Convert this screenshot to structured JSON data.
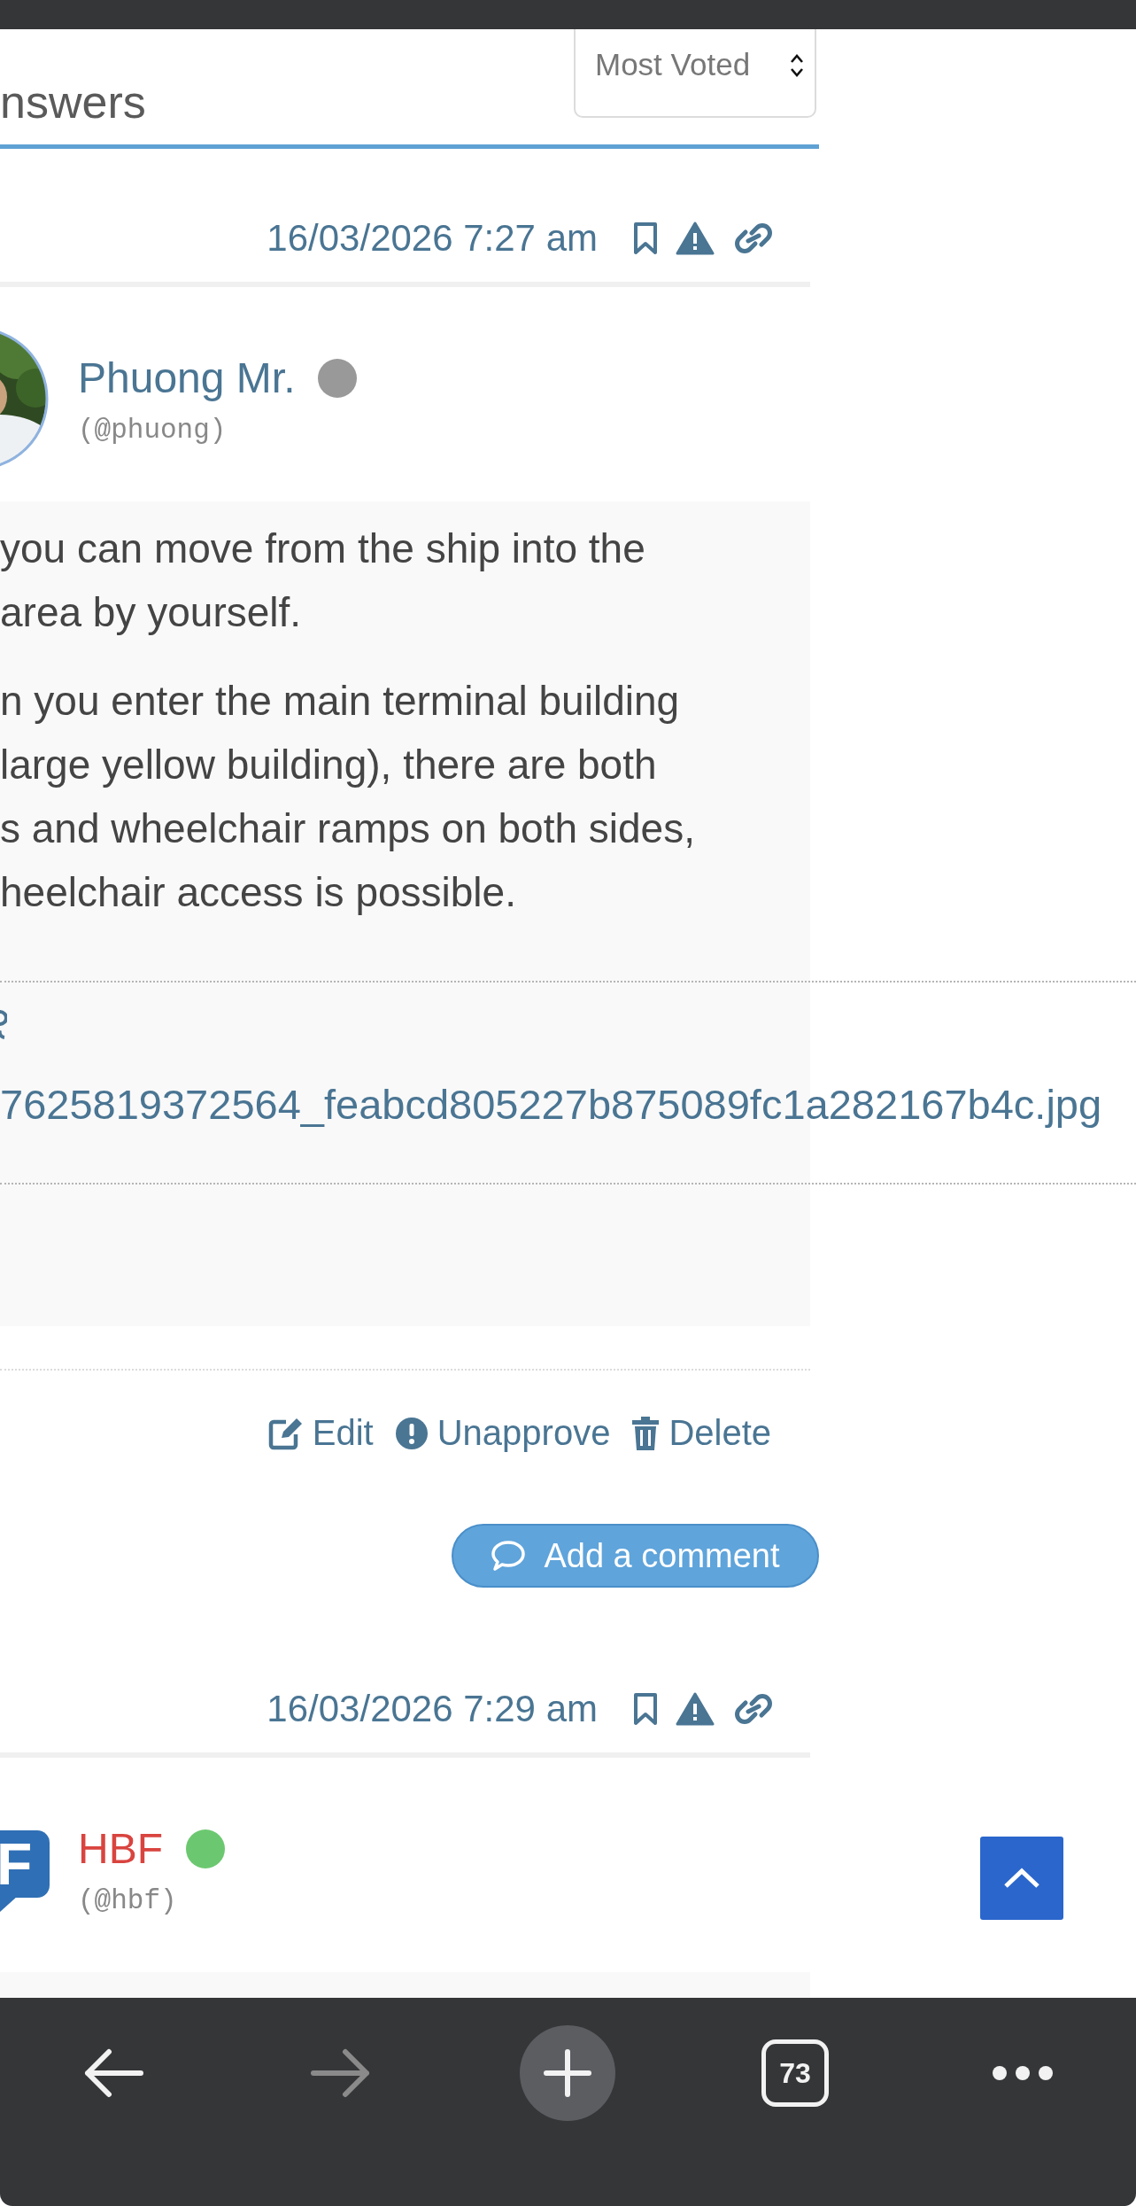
{
  "section": {
    "heading": "nswers",
    "sort": {
      "value": "Most Voted"
    }
  },
  "answers": [
    {
      "date": "16/03/2026 7:27 am",
      "author": {
        "name": "Phuong Mr.",
        "handle": "(@phuong)",
        "kind": "member",
        "color": "#999999"
      },
      "paragraphs": [
        [
          "you can move from the ship into the",
          "area by yourself."
        ],
        [
          "n you enter the main terminal building",
          "large yellow building), there are both",
          "s and wheelchair ramps on both sides,",
          "heelchair access is possible."
        ]
      ],
      "attachment": {
        "filename": "7625819372564_feabcd805227b875089fc1a282167b4c.jpg"
      },
      "actions": [
        {
          "kind": "edit",
          "label": "Edit"
        },
        {
          "kind": "unapprove",
          "label": "Unapprove"
        },
        {
          "kind": "delete",
          "label": "Delete"
        }
      ],
      "comment_button": "Add a comment"
    },
    {
      "date": "16/03/2026 7:29 am",
      "author": {
        "name": "HBF",
        "handle": "(@hbf)",
        "kind": "admin",
        "avatar": {
          "kind": "logo"
        },
        "logo_letter": "F",
        "color": "#6cc870"
      }
    }
  ],
  "browser_toolbar": [
    {
      "kind": "back",
      "disabled": false
    },
    {
      "kind": "forward",
      "disabled": true
    },
    {
      "kind": "new-tab",
      "disabled": false
    },
    {
      "kind": "tabs",
      "count": "73",
      "disabled": false
    },
    {
      "kind": "more",
      "disabled": false
    }
  ]
}
